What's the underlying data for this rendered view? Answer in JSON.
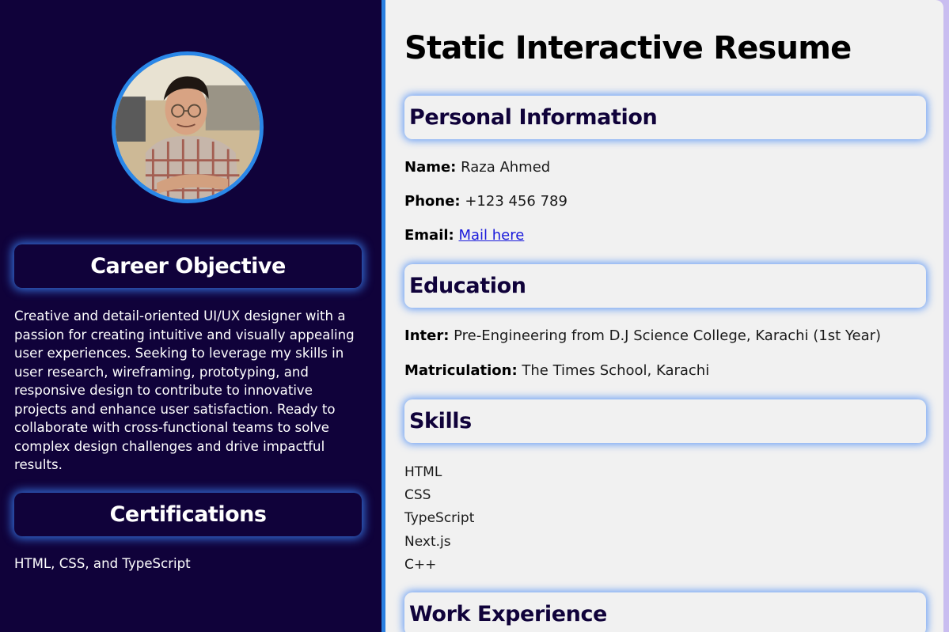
{
  "sidebar": {
    "career_heading": "Career Objective",
    "career_text": "Creative and detail-oriented UI/UX designer with a passion for creating intuitive and visually appealing user experiences. Seeking to leverage my skills in user research, wireframing, prototyping, and responsive design to contribute to innovative projects and enhance user satisfaction. Ready to collaborate with cross-functional teams to solve complex design challenges and drive impactful results.",
    "cert_heading": "Certifications",
    "cert_text": "HTML, CSS, and TypeScript"
  },
  "main": {
    "title": "Static Interactive Resume",
    "personal": {
      "heading": "Personal Information",
      "name_label": "Name:",
      "name_value": "Raza Ahmed",
      "phone_label": "Phone:",
      "phone_value": "+123 456 789",
      "email_label": "Email:",
      "email_link": "Mail here"
    },
    "education": {
      "heading": "Education",
      "inter_label": "Inter:",
      "inter_value": "Pre-Engineering from D.J Science College, Karachi (1st Year)",
      "matric_label": "Matriculation:",
      "matric_value": "The Times School, Karachi"
    },
    "skills": {
      "heading": "Skills",
      "items": [
        "HTML",
        "CSS",
        "TypeScript",
        "Next.js",
        "C++"
      ]
    },
    "work": {
      "heading": "Work Experience"
    }
  },
  "colors": {
    "sidebar_bg": "#10023a",
    "accent_blue": "#2a87e8",
    "main_bg": "#f1f1f1",
    "heading_text": "#10023a",
    "link": "#1a1adb"
  }
}
